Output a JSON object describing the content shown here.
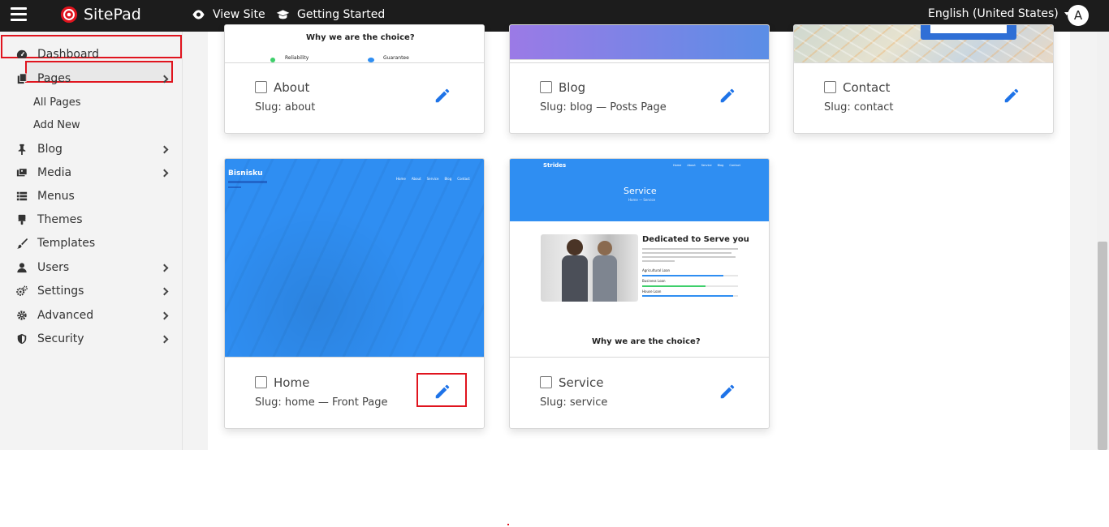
{
  "topbar": {
    "app_name": "SitePad",
    "view_site": "View Site",
    "getting_started": "Getting Started",
    "language": "English (United States)",
    "avatar_letter": "A"
  },
  "sidebar": {
    "items": [
      {
        "label": "Dashboard",
        "icon": "dashboard-icon"
      },
      {
        "label": "Pages",
        "icon": "pages-icon"
      },
      {
        "label": "Blog",
        "icon": "pin-icon"
      },
      {
        "label": "Media",
        "icon": "media-icon"
      },
      {
        "label": "Menus",
        "icon": "menu-list-icon"
      },
      {
        "label": "Themes",
        "icon": "brush-icon"
      },
      {
        "label": "Templates",
        "icon": "paintbrush-icon"
      },
      {
        "label": "Users",
        "icon": "user-icon"
      },
      {
        "label": "Settings",
        "icon": "gears-icon"
      },
      {
        "label": "Advanced",
        "icon": "gear-icon"
      },
      {
        "label": "Security",
        "icon": "shield-icon"
      }
    ],
    "sub_items": [
      "All Pages",
      "Add New"
    ]
  },
  "pages": [
    {
      "title": "About",
      "slug": "Slug: about",
      "thumb_text": "Why we are the choice?",
      "thumb_label_1": "Reliability",
      "thumb_label_2": "Guarantee"
    },
    {
      "title": "Blog",
      "slug": "Slug: blog — Posts Page"
    },
    {
      "title": "Contact",
      "slug": "Slug: contact"
    },
    {
      "title": "Home",
      "slug": "Slug: home — Front Page",
      "thumb_brand": "Bisnisku",
      "thumb_nav": [
        "Home",
        "About",
        "Service",
        "Blog",
        "Contact"
      ]
    },
    {
      "title": "Service",
      "slug": "Slug: service",
      "thumb_brand": "Strides",
      "thumb_heading": "Service",
      "thumb_section": "Dedicated to Serve you",
      "thumb_bottom": "Why we are the choice?",
      "thumb_nav": [
        "Home",
        "About",
        "Service",
        "Blog",
        "Contact"
      ],
      "thumb_breadcrumb": "Home — Service",
      "thumb_bars": [
        "Agricultural Loan",
        "Business Loan",
        "House Loan"
      ]
    }
  ],
  "colors": {
    "accent_blue": "#2f8ef2",
    "highlight_red": "#e0141e",
    "topbar": "#1c1c1c",
    "edit_icon": "#1e73e8"
  }
}
